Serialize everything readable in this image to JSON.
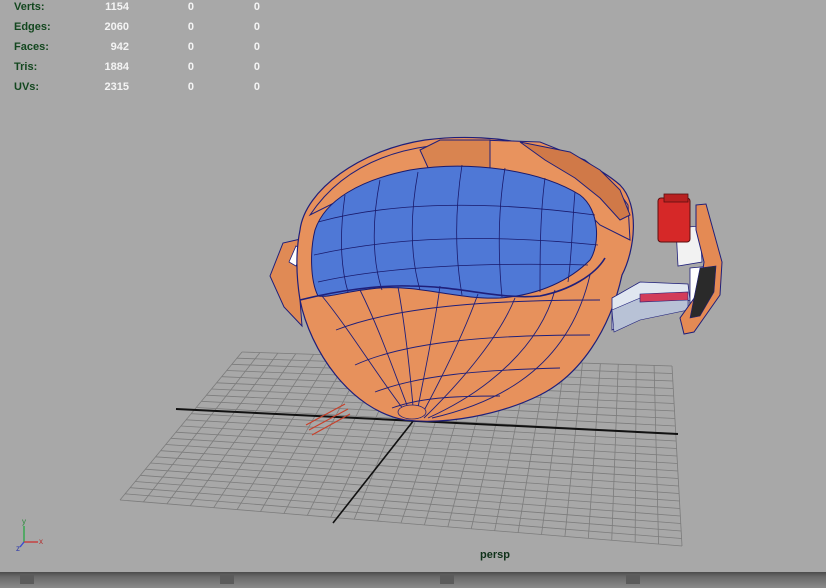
{
  "heads_up": {
    "rows": [
      {
        "label": "Verts:",
        "values": [
          "1154",
          "0",
          "0"
        ]
      },
      {
        "label": "Edges:",
        "values": [
          "2060",
          "0",
          "0"
        ]
      },
      {
        "label": "Faces:",
        "values": [
          "942",
          "0",
          "0"
        ]
      },
      {
        "label": "Tris:",
        "values": [
          "1884",
          "0",
          "0"
        ]
      },
      {
        "label": "UVs:",
        "values": [
          "2315",
          "0",
          "0"
        ]
      }
    ]
  },
  "camera": {
    "name": "persp"
  },
  "axis_indicator": {
    "y": "y",
    "x": "x",
    "z": "z"
  },
  "colors": {
    "viewport_bg": "#a8a8a8",
    "hud_label": "#13471f",
    "hud_value": "#f4f4f4",
    "model_orange": "#e48a54",
    "model_blue": "#4f78d8",
    "wire": "#1f1f7a",
    "grid": "#7a7a7a",
    "red_part": "#d4282a"
  }
}
